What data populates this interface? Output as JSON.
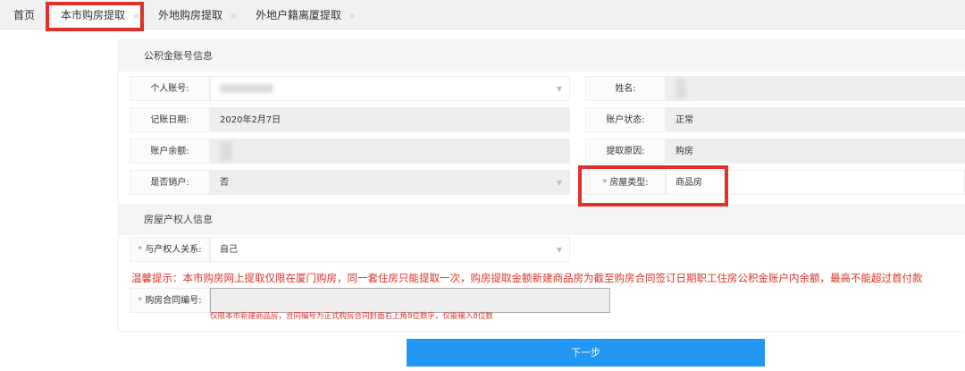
{
  "tabs": [
    {
      "label": "首页"
    },
    {
      "label": "本市购房提取",
      "close": "×",
      "active": true
    },
    {
      "label": "外地购房提取",
      "close": "×"
    },
    {
      "label": "外地户籍离厦提取",
      "close": "×"
    }
  ],
  "section1": {
    "title": "公积金账号信息",
    "fields": {
      "account": {
        "label": "个人账号:",
        "value": ""
      },
      "name": {
        "label": "姓名:",
        "value": ""
      },
      "date": {
        "label": "记账日期:",
        "value": "2020年2月7日"
      },
      "status": {
        "label": "账户状态:",
        "value": "正常"
      },
      "balance": {
        "label": "账户余额:",
        "value": ""
      },
      "reason": {
        "label": "提取原因:",
        "value": "购房"
      },
      "closed": {
        "label": "是否销户:",
        "value": "否"
      },
      "house_type": {
        "required": "*",
        "label": "房屋类型:",
        "value": "商品房"
      }
    }
  },
  "section2": {
    "title": "房屋产权人信息",
    "relation": {
      "required": "*",
      "label": "与产权人关系:",
      "value": "自己"
    },
    "warning": "温馨提示：本市购房网上提取仅限在厦门购房，同一套住房只能提取一次，购房提取金额新建商品房为截至购房合同签订日期职工住房公积金账户内余额，最高不能超过首付款",
    "contract": {
      "required": "*",
      "label": "购房合同编号:",
      "value": "",
      "hint": "仅限本市新建商品房，合同编号为正式购房合同封面右上角8位数字，仅能输入8位数"
    }
  },
  "next_button": "下一步",
  "colors": {
    "accent": "#2196f3",
    "warning": "#d9342b",
    "highlight": "#e0302b"
  }
}
